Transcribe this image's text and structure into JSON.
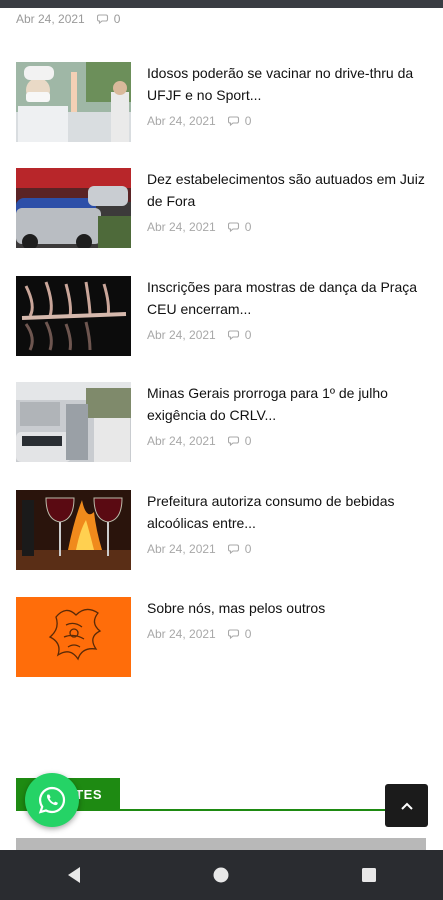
{
  "top_meta": {
    "date": "Abr 24, 2021",
    "comments": "0"
  },
  "posts": [
    {
      "title": "Idosos poderão se vacinar no drive-thru da UFJF e no Sport...",
      "date": "Abr 24, 2021",
      "comments": "0"
    },
    {
      "title": "Dez estabelecimentos são autuados em Juiz de Fora",
      "date": "Abr 24, 2021",
      "comments": "0"
    },
    {
      "title": "Inscrições para mostras de dança da Praça CEU encerram...",
      "date": "Abr 24, 2021",
      "comments": "0"
    },
    {
      "title": "Minas Gerais prorroga para 1º de julho exigência do CRLV...",
      "date": "Abr 24, 2021",
      "comments": "0"
    },
    {
      "title": "Prefeitura autoriza consumo de bebidas alcoólicas entre...",
      "date": "Abr 24, 2021",
      "comments": "0"
    },
    {
      "title": "Sobre nós, mas pelos outros",
      "date": "Abr 24, 2021",
      "comments": "0"
    }
  ],
  "section": {
    "label": "TES"
  },
  "colors": {
    "accent_green": "#1e8a12",
    "whatsapp": "#25d366",
    "navbar": "#2a2c30"
  },
  "icons": {
    "comment": "comment-icon",
    "whatsapp": "whatsapp-icon",
    "scroll_top": "chevron-up-icon",
    "nav_back": "back-triangle-icon",
    "nav_home": "home-circle-icon",
    "nav_recent": "recent-square-icon"
  }
}
